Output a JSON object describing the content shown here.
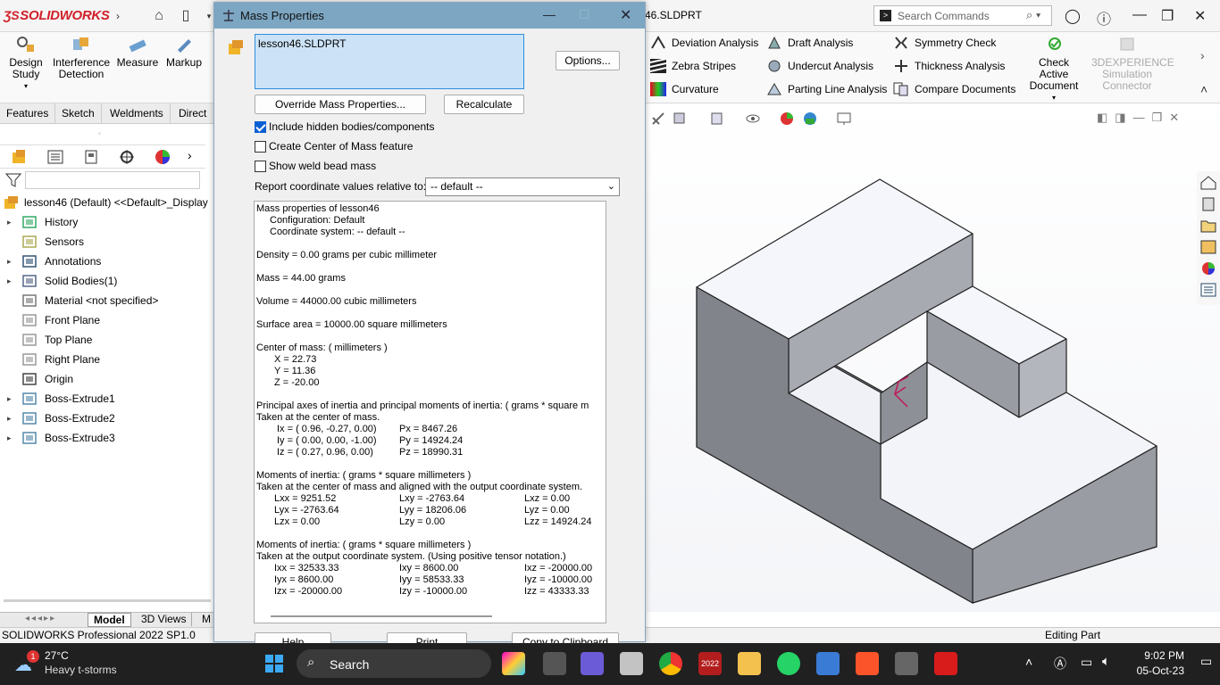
{
  "app": {
    "name": "SOLIDWORKS",
    "doc_title": "46.SLDPRT",
    "search_placeholder": "Search Commands"
  },
  "command_manager": {
    "big_buttons": [
      "Design Study",
      "Interference Detection",
      "Measure",
      "Markup"
    ],
    "small_buttons": [
      "Deviation Analysis",
      "Zebra Stripes",
      "Curvature",
      "Draft Analysis",
      "Undercut Analysis",
      "Parting Line Analysis",
      "Symmetry Check",
      "Thickness Analysis",
      "Compare Documents"
    ],
    "check_active": "Check Active Document",
    "experience": "3DEXPERIENCE Simulation Connector"
  },
  "tabs": [
    "Features",
    "Sketch",
    "Weldments",
    "Direct E"
  ],
  "tree": {
    "root": "lesson46 (Default) <<Default>_Display",
    "items": [
      "History",
      "Sensors",
      "Annotations",
      "Solid Bodies(1)",
      "Material <not specified>",
      "Front Plane",
      "Top Plane",
      "Right Plane",
      "Origin",
      "Boss-Extrude1",
      "Boss-Extrude2",
      "Boss-Extrude3"
    ]
  },
  "bottom_tabs": [
    "Model",
    "3D Views",
    "M"
  ],
  "statusbar": {
    "left": "SOLIDWORKS Professional 2022 SP1.0",
    "right": "Editing Part"
  },
  "dialog": {
    "title": "Mass Properties",
    "selection": "lesson46.SLDPRT",
    "options": "Options...",
    "override": "Override Mass Properties...",
    "recalculate": "Recalculate",
    "chk_hidden": "Include hidden bodies/components",
    "chk_com": "Create Center of Mass feature",
    "chk_weld": "Show weld bead mass",
    "report_label": "Report coordinate values relative to:",
    "report_value": "-- default --",
    "bottom_buttons": [
      "Help",
      "Print",
      "Copy to Clipboard"
    ],
    "results": {
      "header": "Mass properties of lesson46",
      "config": "Configuration: Default",
      "coord": "Coordinate system: -- default --",
      "density": "Density = 0.00 grams per cubic millimeter",
      "mass": "Mass = 44.00 grams",
      "volume": "Volume = 44000.00 cubic millimeters",
      "area": "Surface area = 10000.00  square millimeters",
      "com_title": "Center of mass: ( millimeters )",
      "com_x": "X = 22.73",
      "com_y": "Y = 11.36",
      "com_z": "Z = -20.00",
      "pa_title": "Principal axes of inertia and principal moments of inertia: ( grams *  square m",
      "pa_taken": "Taken at the center of mass.",
      "pa_rows": [
        [
          "Ix = ( 0.96, -0.27,  0.00)",
          "Px = 8467.26"
        ],
        [
          "Iy = ( 0.00,  0.00, -1.00)",
          "Py = 14924.24"
        ],
        [
          "Iz = ( 0.27,  0.96,  0.00)",
          "Pz = 18990.31"
        ]
      ],
      "m1_title": "Moments of inertia: ( grams *  square millimeters )",
      "m1_taken": "Taken at the center of mass and aligned with the output coordinate system.",
      "m1_rows": [
        [
          "Lxx = 9251.52",
          "Lxy = -2763.64",
          "Lxz = 0.00"
        ],
        [
          "Lyx = -2763.64",
          "Lyy = 18206.06",
          "Lyz = 0.00"
        ],
        [
          "Lzx = 0.00",
          "Lzy = 0.00",
          "Lzz = 14924.24"
        ]
      ],
      "m2_title": "Moments of inertia: ( grams *  square millimeters )",
      "m2_taken": "Taken at the output coordinate system. (Using positive tensor notation.)",
      "m2_rows": [
        [
          "Ixx = 32533.33",
          "Ixy = 8600.00",
          "Ixz = -20000.00"
        ],
        [
          "Iyx = 8600.00",
          "Iyy = 58533.33",
          "Iyz = -10000.00"
        ],
        [
          "Izx = -20000.00",
          "Izy = -10000.00",
          "Izz = 43333.33"
        ]
      ]
    }
  },
  "taskbar": {
    "weather_temp": "27°C",
    "weather_desc": "Heavy t-storms",
    "weather_badge": "1",
    "search": "Search",
    "time": "9:02 PM",
    "date": "05-Oct-23",
    "sw_badge": "2022"
  },
  "colors": {
    "accent": "#0b5fd4",
    "dialog_title": "#7ca6c2",
    "selection": "#cce3f7"
  }
}
